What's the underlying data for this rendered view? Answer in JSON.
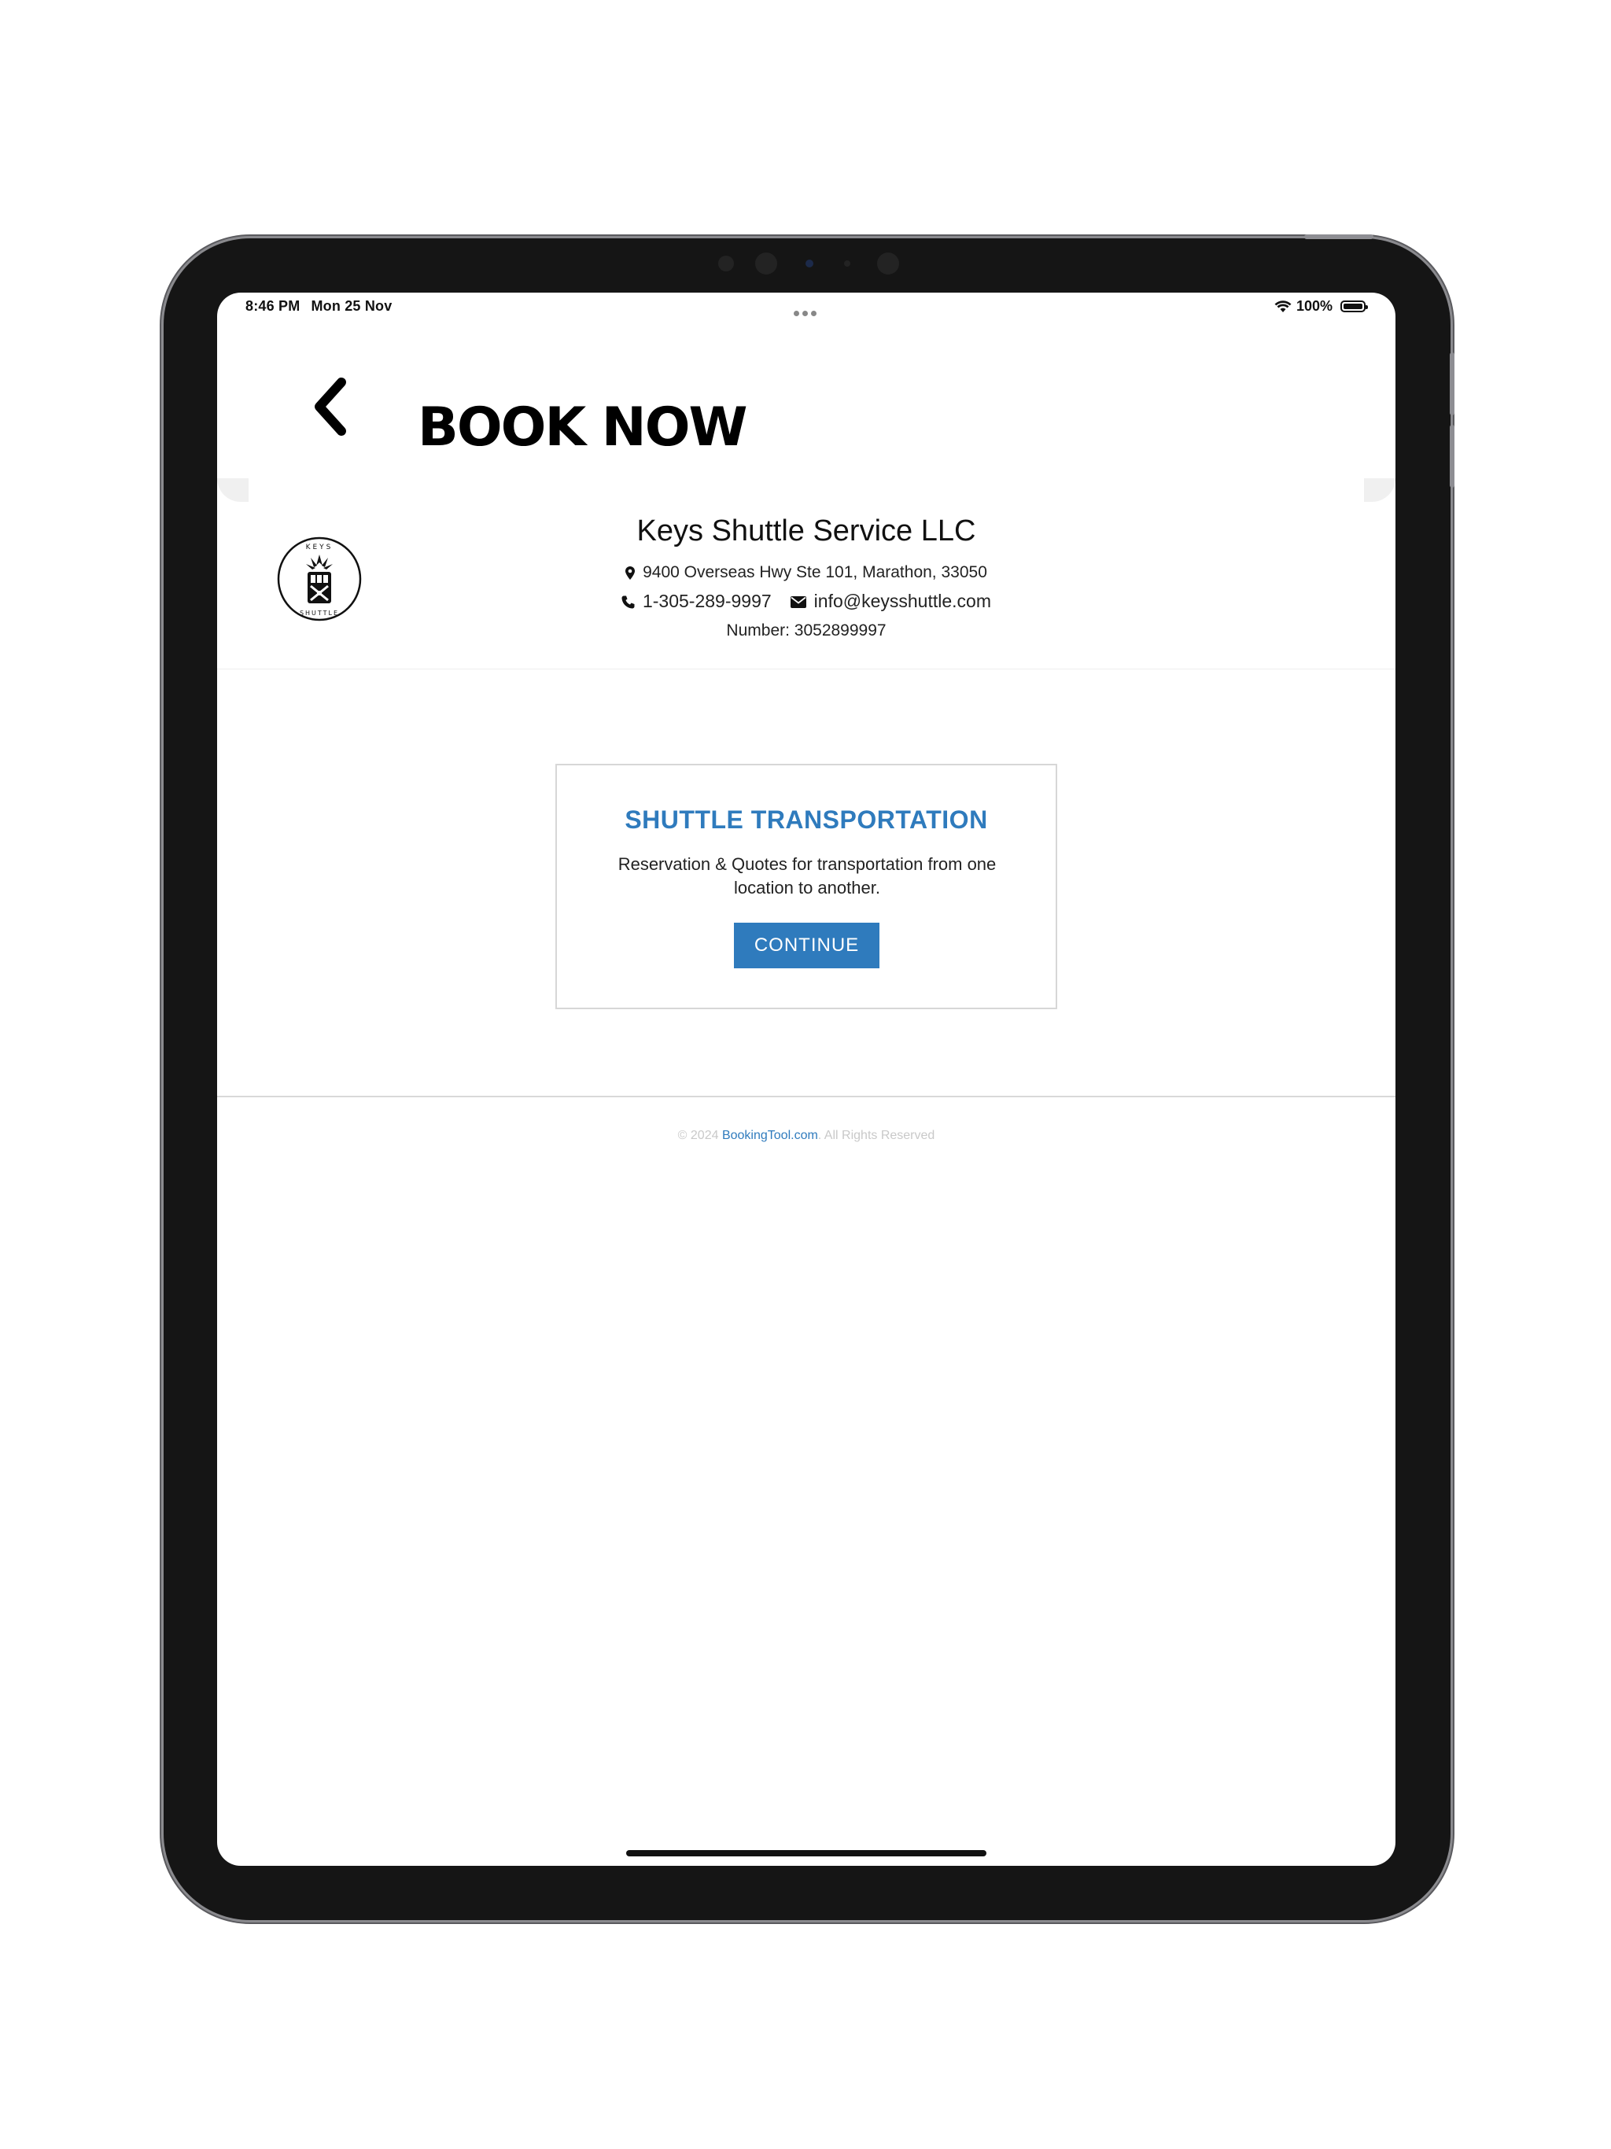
{
  "status_bar": {
    "time": "8:46 PM",
    "date": "Mon 25 Nov",
    "battery": "100%"
  },
  "header": {
    "title": "BOOK NOW",
    "back_icon": "chevron-left-icon"
  },
  "company": {
    "name": "Keys Shuttle Service LLC",
    "address": "9400 Overseas Hwy Ste 101, Marathon, 33050",
    "phone": "1-305-289-9997",
    "email": "info@keysshuttle.com",
    "number": "Number: 3052899997",
    "logo_top_text": "KEYS",
    "logo_bottom_text": "SHUTTLE"
  },
  "service_card": {
    "title": "SHUTTLE TRANSPORTATION",
    "description": "Reservation & Quotes for transportation from one location to another.",
    "button_label": "CONTINUE"
  },
  "footer": {
    "prefix": "© 2024 ",
    "link": "BookingTool.com",
    "suffix": ". All Rights Reserved"
  },
  "colors": {
    "accent": "#2f7bbd",
    "device_frame": "#151515"
  }
}
